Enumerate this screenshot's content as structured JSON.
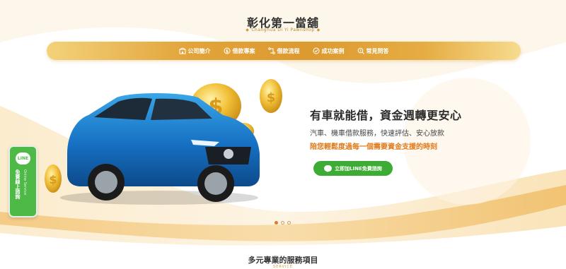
{
  "brand": {
    "title": "彰化第一當舖",
    "subtitle": "Changhua Di Yi Pawnshop"
  },
  "nav": {
    "items": [
      {
        "label": "公司簡介",
        "icon": "building-icon"
      },
      {
        "label": "借款專案",
        "icon": "dollar-coin-icon"
      },
      {
        "label": "借款流程",
        "icon": "flow-icon"
      },
      {
        "label": "成功案例",
        "icon": "check-circle-icon"
      },
      {
        "label": "常見問答",
        "icon": "search-question-icon"
      }
    ]
  },
  "hero": {
    "title": "有車就能借，資金週轉更安心",
    "line1": "汽車、機車借款服務，快速評估、安心放款",
    "line2": "陪您輕鬆度過每一個需要資金支援的時刻",
    "cta_label": "立即加LINE免費諮詢"
  },
  "side_tab": {
    "badge": "LINE",
    "label": "免費線上諮詢",
    "label_en": "Online Service"
  },
  "carousel": {
    "slides": 3,
    "active": 1
  },
  "section": {
    "title": "多元專業的服務項目",
    "subtitle": "SERVICE"
  },
  "colors": {
    "accent": "#e2a43a",
    "line_green": "#3cac34",
    "highlight": "#e07a1a"
  }
}
